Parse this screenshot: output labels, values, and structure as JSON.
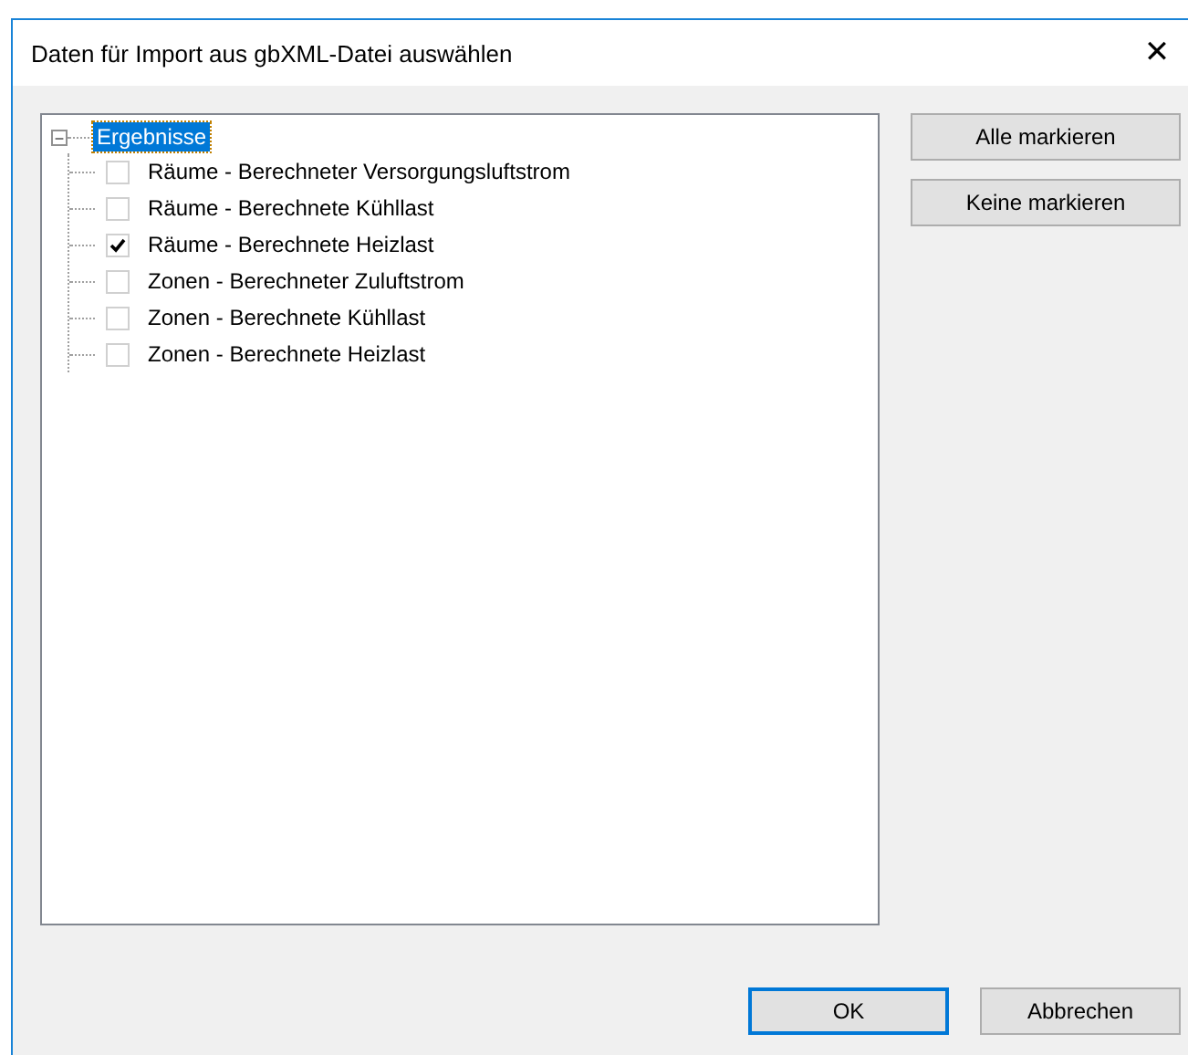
{
  "window": {
    "title": "Daten für Import aus gbXML-Datei auswählen",
    "close": "✕"
  },
  "tree": {
    "root": {
      "expander": "−",
      "label": "Ergebnisse",
      "selected": true,
      "expanded": true,
      "children": [
        {
          "label": "Räume - Berechneter Versorgungsluftstrom",
          "checked": false
        },
        {
          "label": "Räume - Berechnete Kühllast",
          "checked": false
        },
        {
          "label": "Räume - Berechnete Heizlast",
          "checked": true
        },
        {
          "label": "Zonen - Berechneter Zuluftstrom",
          "checked": false
        },
        {
          "label": "Zonen - Berechnete Kühllast",
          "checked": false
        },
        {
          "label": "Zonen - Berechnete Heizlast",
          "checked": false
        }
      ]
    }
  },
  "side_buttons": [
    "Alle markieren",
    "Keine markieren"
  ],
  "footer_buttons": [
    {
      "label": "OK",
      "default": true
    },
    {
      "label": "Abbrechen",
      "default": false
    }
  ]
}
